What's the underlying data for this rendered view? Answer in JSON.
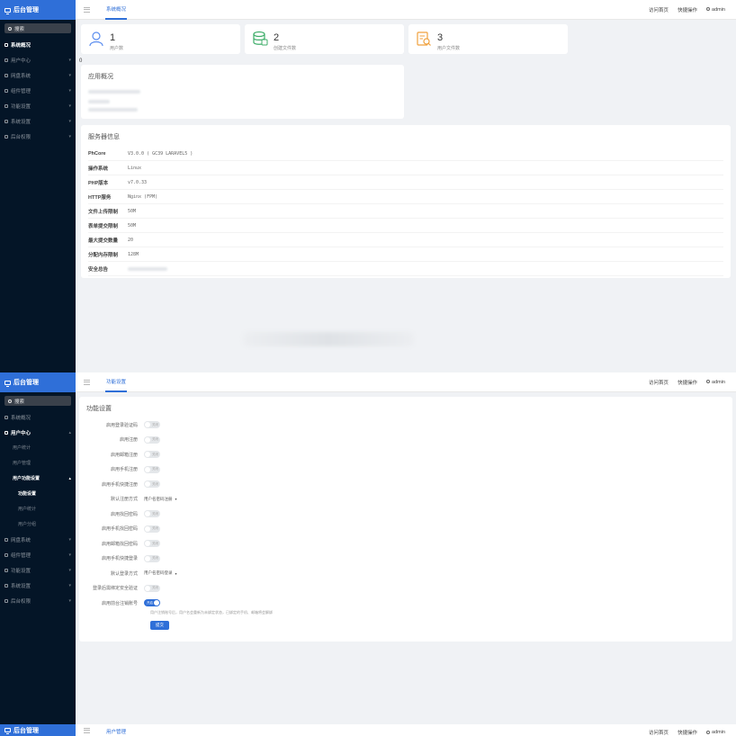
{
  "brand": "后台管理",
  "search_label": "搜索",
  "topbar": {
    "visit_home": "访问首页",
    "quick_ops": "快捷操作",
    "user": "admin"
  },
  "screen1": {
    "tab": "系统概况",
    "nav": [
      {
        "label": "系统概况",
        "active": true
      },
      {
        "label": "用户中心"
      },
      {
        "label": "网盘系统"
      },
      {
        "label": "组件管理"
      },
      {
        "label": "功能设置"
      },
      {
        "label": "系统设置"
      },
      {
        "label": "后台权限"
      }
    ],
    "stats": [
      {
        "value": "1",
        "label": "用户数",
        "icon": "user-icon",
        "color": "#5b8def"
      },
      {
        "value": "2",
        "label": "创建文件数",
        "icon": "database-icon",
        "color": "#3fae6a"
      },
      {
        "value": "3",
        "label": "用户文件数",
        "icon": "file-search-icon",
        "color": "#f0a03c"
      }
    ],
    "zero_marker": "0",
    "app_card_title": "应用概况",
    "server_card_title": "服务器信息",
    "server_info": [
      {
        "key": "PhCore",
        "value": "V3.0.0 ( GC39 LARAVEL5 )"
      },
      {
        "key": "操作系统",
        "value": "Linux"
      },
      {
        "key": "PHP版本",
        "value": "v7.0.33"
      },
      {
        "key": "HTTP服务",
        "value": "Nginx (FPM)"
      },
      {
        "key": "文件上传限制",
        "value": "50M"
      },
      {
        "key": "表单提交限制",
        "value": "50M"
      },
      {
        "key": "最大提交数量",
        "value": "20"
      },
      {
        "key": "分配内存限制",
        "value": "128M"
      },
      {
        "key": "安全总告",
        "value": ""
      }
    ]
  },
  "screen2": {
    "tab": "功能设置",
    "nav": [
      {
        "label": "系统概况",
        "type": "top"
      },
      {
        "label": "用户中心",
        "type": "top",
        "active": true,
        "expanded": true
      },
      {
        "label": "用户统计",
        "type": "sub"
      },
      {
        "label": "用户管理",
        "type": "sub"
      },
      {
        "label": "用户功能设置",
        "type": "sub",
        "active": true,
        "expanded": true
      },
      {
        "label": "功能设置",
        "type": "deep",
        "active": true
      },
      {
        "label": "用户统计",
        "type": "deep"
      },
      {
        "label": "用户分组",
        "type": "deep"
      },
      {
        "label": "网盘系统",
        "type": "top"
      },
      {
        "label": "组件管理",
        "type": "top"
      },
      {
        "label": "功能设置",
        "type": "top"
      },
      {
        "label": "系统设置",
        "type": "top"
      },
      {
        "label": "后台权限",
        "type": "top"
      }
    ],
    "form_title": "功能设置",
    "switch_off": "关闭",
    "switch_on": "开启",
    "rows": [
      {
        "label": "启用登录验证码",
        "type": "switch",
        "on": false
      },
      {
        "label": "启用注册",
        "type": "switch",
        "on": false
      },
      {
        "label": "启用邮箱注册",
        "type": "switch",
        "on": false
      },
      {
        "label": "启用手机注册",
        "type": "switch",
        "on": false
      },
      {
        "label": "启用手机快捷注册",
        "type": "switch",
        "on": false
      },
      {
        "label": "默认注册方式",
        "type": "select",
        "value": "用户名密码注册"
      },
      {
        "label": "启用找回密码",
        "type": "switch",
        "on": false
      },
      {
        "label": "启用手机找回密码",
        "type": "switch",
        "on": false
      },
      {
        "label": "启用邮箱找回密码",
        "type": "switch",
        "on": false
      },
      {
        "label": "启用手机快捷登录",
        "type": "switch",
        "on": false
      },
      {
        "label": "默认登录方式",
        "type": "select",
        "value": "用户名密码登录"
      },
      {
        "label": "登录后需绑定安全验证",
        "type": "switch",
        "on": false
      },
      {
        "label": "启用前台注销账号",
        "type": "switch",
        "on": true
      }
    ],
    "hint": "用户注销账号后，用户名会重新为未绑定状态，已绑定的手机、邮箱将会解绑",
    "submit_label": "提交"
  },
  "screen3": {
    "tab": "用户管理"
  }
}
